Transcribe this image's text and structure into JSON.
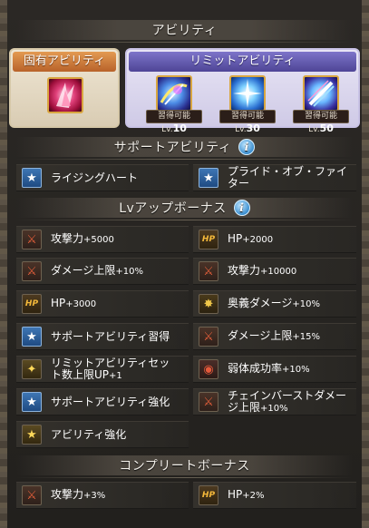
{
  "abilities": {
    "title": "アビリティ",
    "innate": {
      "label": "固有アビリティ",
      "icon": "innate-ability-icon"
    },
    "limit": {
      "label": "リミットアビリティ",
      "items": [
        {
          "tag_prefix": "習得可能Lv.",
          "level": "10"
        },
        {
          "tag_prefix": "習得可能Lv.",
          "level": "30"
        },
        {
          "tag_prefix": "習得可能Lv.",
          "level": "50"
        }
      ]
    }
  },
  "support": {
    "title": "サポートアビリティ",
    "items": [
      "ライジングハート",
      "プライド・オブ・ファイター"
    ]
  },
  "lvup": {
    "title": "Lvアップボーナス",
    "left": [
      {
        "icon": "swords",
        "label": "攻撃力",
        "value": "+5000"
      },
      {
        "icon": "swords",
        "label": "ダメージ上限",
        "value": "+10%"
      },
      {
        "icon": "hp",
        "label": "HP",
        "value": "+3000"
      },
      {
        "icon": "star",
        "label": "サポートアビリティ習得",
        "value": ""
      },
      {
        "icon": "gold",
        "label": "リミットアビリティセット数上限UP",
        "value": "+1"
      },
      {
        "icon": "star",
        "label": "サポートアビリティ強化",
        "value": ""
      },
      {
        "icon": "gold",
        "label": "アビリティ強化",
        "value": ""
      }
    ],
    "right": [
      {
        "icon": "hp",
        "label": "HP",
        "value": "+2000"
      },
      {
        "icon": "swords",
        "label": "攻撃力",
        "value": "+10000"
      },
      {
        "icon": "burst",
        "label": "奥義ダメージ",
        "value": "+10%"
      },
      {
        "icon": "swords",
        "label": "ダメージ上限",
        "value": "+15%"
      },
      {
        "icon": "debuff",
        "label": "弱体成功率",
        "value": "+10%"
      },
      {
        "icon": "swords",
        "label": "チェインバーストダメージ上限",
        "value": "+10%"
      }
    ]
  },
  "complete": {
    "title": "コンプリートボーナス",
    "left": {
      "icon": "swords",
      "label": "攻撃力",
      "value": "+3%"
    },
    "right": {
      "icon": "hp",
      "label": "HP",
      "value": "+2%"
    }
  }
}
